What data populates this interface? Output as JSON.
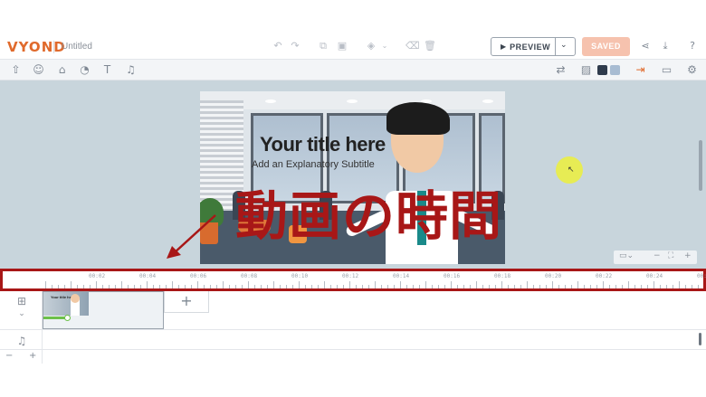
{
  "app": {
    "logo": "VYOND",
    "document_title": "Untitled"
  },
  "header": {
    "preview_label": "PREVIEW",
    "saved_label": "SAVED",
    "icons": [
      "undo-icon",
      "redo-icon",
      "copy-icon",
      "paste-icon",
      "layers-icon",
      "clean-icon",
      "trash-icon",
      "share-icon",
      "download-icon",
      "help-icon"
    ]
  },
  "toolbar": {
    "left_icons": [
      "upload-icon",
      "character-icon",
      "prop-icon",
      "chart-icon",
      "text-icon",
      "music-icon"
    ],
    "right_icons": [
      "swap-icon",
      "image-icon",
      "exit-icon",
      "camera-icon",
      "settings-icon"
    ],
    "swatch_colors": [
      "#2f3b4c",
      "#a8bcd2"
    ]
  },
  "canvas": {
    "title": "Your title here",
    "subtitle": "Add an Explanatory Subtitle"
  },
  "overlay": {
    "caption": "動画の時間",
    "color": "#a81717"
  },
  "timeline": {
    "ruler_labels": [
      "00:02",
      "00:04",
      "00:06",
      "00:08",
      "00:10",
      "00:12",
      "00:14",
      "00:16",
      "00:18",
      "00:20",
      "00:22",
      "00:24",
      "00:2"
    ],
    "add_scene_label": "+",
    "zoom_out_label": "−",
    "zoom_in_label": "+",
    "scene_progress": 0.2
  },
  "stage_zoom": {
    "minus": "−",
    "plus": "+"
  }
}
